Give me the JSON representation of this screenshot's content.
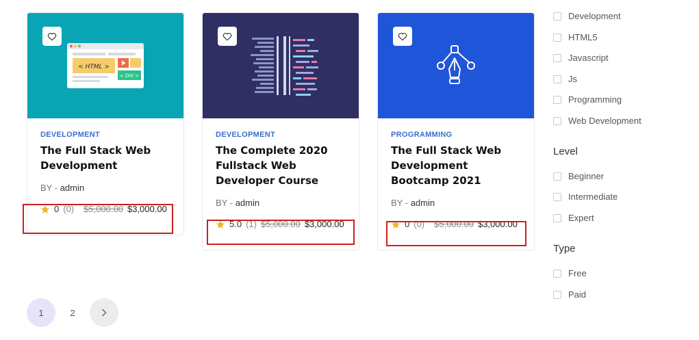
{
  "courses": [
    {
      "category": "DEVELOPMENT",
      "title": "The Full Stack Web Development",
      "by_label": "BY -",
      "author": "admin",
      "rating": "0",
      "rating_count": "(0)",
      "old_price": "$5,000.00",
      "price": "$3,000.00",
      "thumb_color": "#0aa5b5"
    },
    {
      "category": "DEVELOPMENT",
      "title": "The Complete 2020 Fullstack Web Developer Course",
      "by_label": "BY -",
      "author": "admin",
      "rating": "5.0",
      "rating_count": "(1)",
      "old_price": "$5,000.00",
      "price": "$3,000.00",
      "thumb_color": "#2f2f63"
    },
    {
      "category": "PROGRAMMING",
      "title": "The Full Stack Web Development Bootcamp 2021",
      "by_label": "BY -",
      "author": "admin",
      "rating": "0",
      "rating_count": "(0)",
      "old_price": "$5,000.00",
      "price": "$3,000.00",
      "thumb_color": "#1f55d8"
    }
  ],
  "thumb1_text": {
    "html": "< HTML >",
    "div": "< DIV >"
  },
  "filters": {
    "categories": [
      "Development",
      "HTML5",
      "Javascript",
      "Js",
      "Programming",
      "Web Development"
    ],
    "level_heading": "Level",
    "levels": [
      "Beginner",
      "Intermediate",
      "Expert"
    ],
    "type_heading": "Type",
    "types": [
      "Free",
      "Paid"
    ]
  },
  "pagination": {
    "pages": [
      "1",
      "2"
    ],
    "current": "1"
  },
  "colors": {
    "accent_category": "#3d6dc8",
    "highlight": "#cc1f1f",
    "star": "#f0b429"
  }
}
